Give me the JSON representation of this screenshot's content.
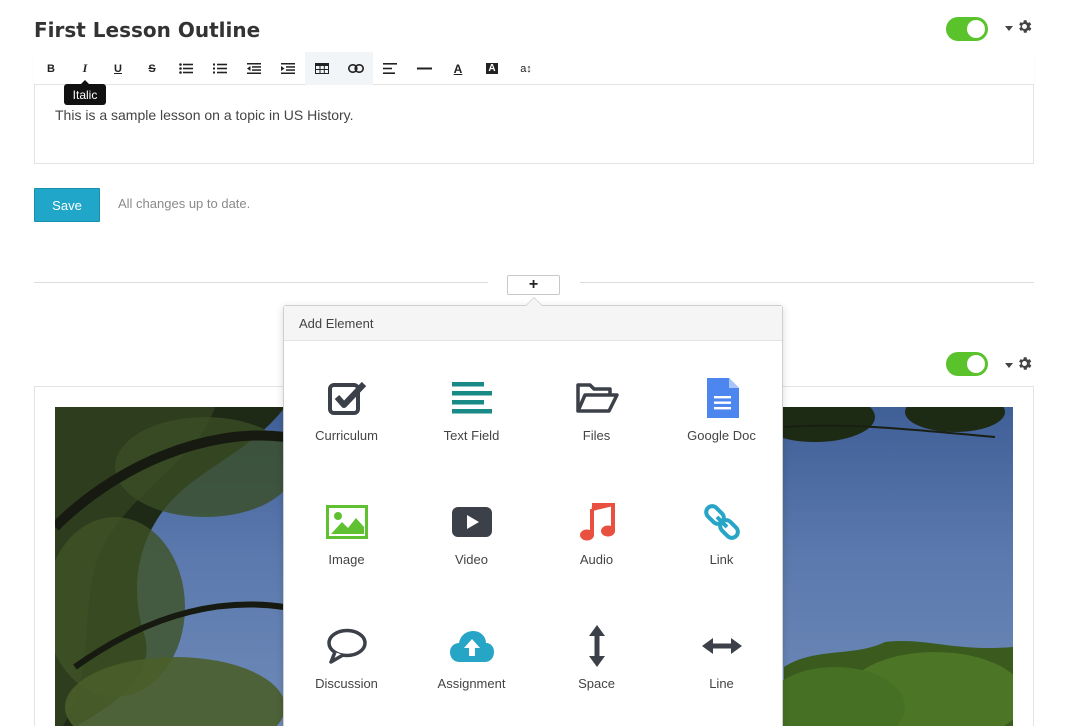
{
  "block1": {
    "title": "First Lesson Outline",
    "toolbar": {
      "buttons": [
        {
          "name": "bold-button",
          "glyph": "B"
        },
        {
          "name": "italic-button",
          "glyph": "I"
        },
        {
          "name": "underline-button",
          "glyph": "U"
        },
        {
          "name": "strikethrough-button",
          "glyph": "S"
        },
        {
          "name": "bullet-list-button",
          "icon": "bullet-list-icon"
        },
        {
          "name": "numbered-list-button",
          "icon": "numbered-list-icon"
        },
        {
          "name": "outdent-button",
          "icon": "outdent-icon"
        },
        {
          "name": "indent-button",
          "icon": "indent-icon"
        },
        {
          "name": "table-button",
          "icon": "table-icon"
        },
        {
          "name": "link-button",
          "icon": "link-icon"
        },
        {
          "name": "align-button",
          "icon": "align-left-icon"
        },
        {
          "name": "horizontal-rule-button",
          "icon": "horizontal-rule-icon"
        },
        {
          "name": "font-color-button",
          "glyph": "A"
        },
        {
          "name": "highlight-color-button",
          "glyph": "A"
        },
        {
          "name": "font-size-button",
          "glyph": "a↕"
        }
      ],
      "tooltip": "Italic"
    },
    "content_text": "This is a sample lesson on a topic in US History.",
    "save_label": "Save",
    "status": "All changes up to date."
  },
  "add_element": {
    "plus_label": "+",
    "header": "Add Element",
    "items": [
      {
        "label": "Curriculum",
        "icon": "checkbox-icon",
        "color": "#3b4049"
      },
      {
        "label": "Text Field",
        "icon": "text-lines-icon",
        "color": "#1a8a87"
      },
      {
        "label": "Files",
        "icon": "folder-open-icon",
        "color": "#3b4049"
      },
      {
        "label": "Google Doc",
        "icon": "google-doc-icon",
        "color": "#4e86f0"
      },
      {
        "label": "Image",
        "icon": "image-icon",
        "color": "#5fc132"
      },
      {
        "label": "Video",
        "icon": "video-play-icon",
        "color": "#3b4049"
      },
      {
        "label": "Audio",
        "icon": "music-note-icon",
        "color": "#e8513f"
      },
      {
        "label": "Link",
        "icon": "chain-link-icon",
        "color": "#27a5c6"
      },
      {
        "label": "Discussion",
        "icon": "speech-bubble-icon",
        "color": "#3b4049"
      },
      {
        "label": "Assignment",
        "icon": "cloud-upload-icon",
        "color": "#27a5c6"
      },
      {
        "label": "Space",
        "icon": "vertical-arrows-icon",
        "color": "#3b4049"
      },
      {
        "label": "Line",
        "icon": "horizontal-arrows-icon",
        "color": "#3b4049"
      }
    ]
  },
  "colors": {
    "toggle_on": "#5ac32b",
    "save_button": "#1fa6c8"
  }
}
